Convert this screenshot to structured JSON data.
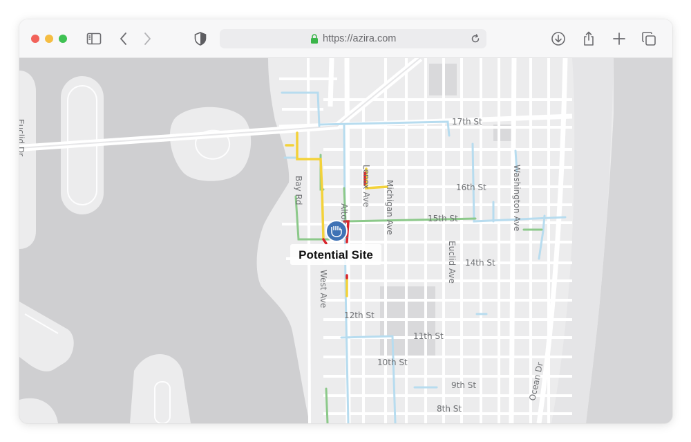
{
  "browser": {
    "url": "https://azira.com",
    "icons": [
      "close-dot",
      "minimize-dot",
      "zoom-dot",
      "sidebar-icon",
      "back-icon",
      "forward-icon",
      "shield-icon",
      "lock-icon",
      "reload-icon",
      "download-icon",
      "share-icon",
      "new-tab-icon",
      "tabs-icon"
    ]
  },
  "map": {
    "marker": {
      "label": "Potential Site",
      "icon": "raised-fist-icon",
      "color": "#3f72b5"
    },
    "streets": {
      "st17": "17th St",
      "st16": "16th St",
      "st15": "15th St",
      "st14": "14th St",
      "st12": "12th St",
      "st11": "11th St",
      "st10": "10th St",
      "st9": "9th St",
      "st8": "8th St",
      "lenox": "Lenox Ave",
      "michigan": "Michigan Ave",
      "bay": "Bay Rd",
      "alton": "Alton Rd",
      "west": "West Ave",
      "euclid": "Euclid Ave",
      "washington": "Washington Ave",
      "ocean": "Ocean Dr",
      "euclid_dr": "Euclid Dr"
    },
    "traffic_colors": {
      "free": "#8cc98a",
      "moderate": "#f3d23a",
      "heavy": "#d8262d",
      "light": "#b7dcef"
    }
  }
}
